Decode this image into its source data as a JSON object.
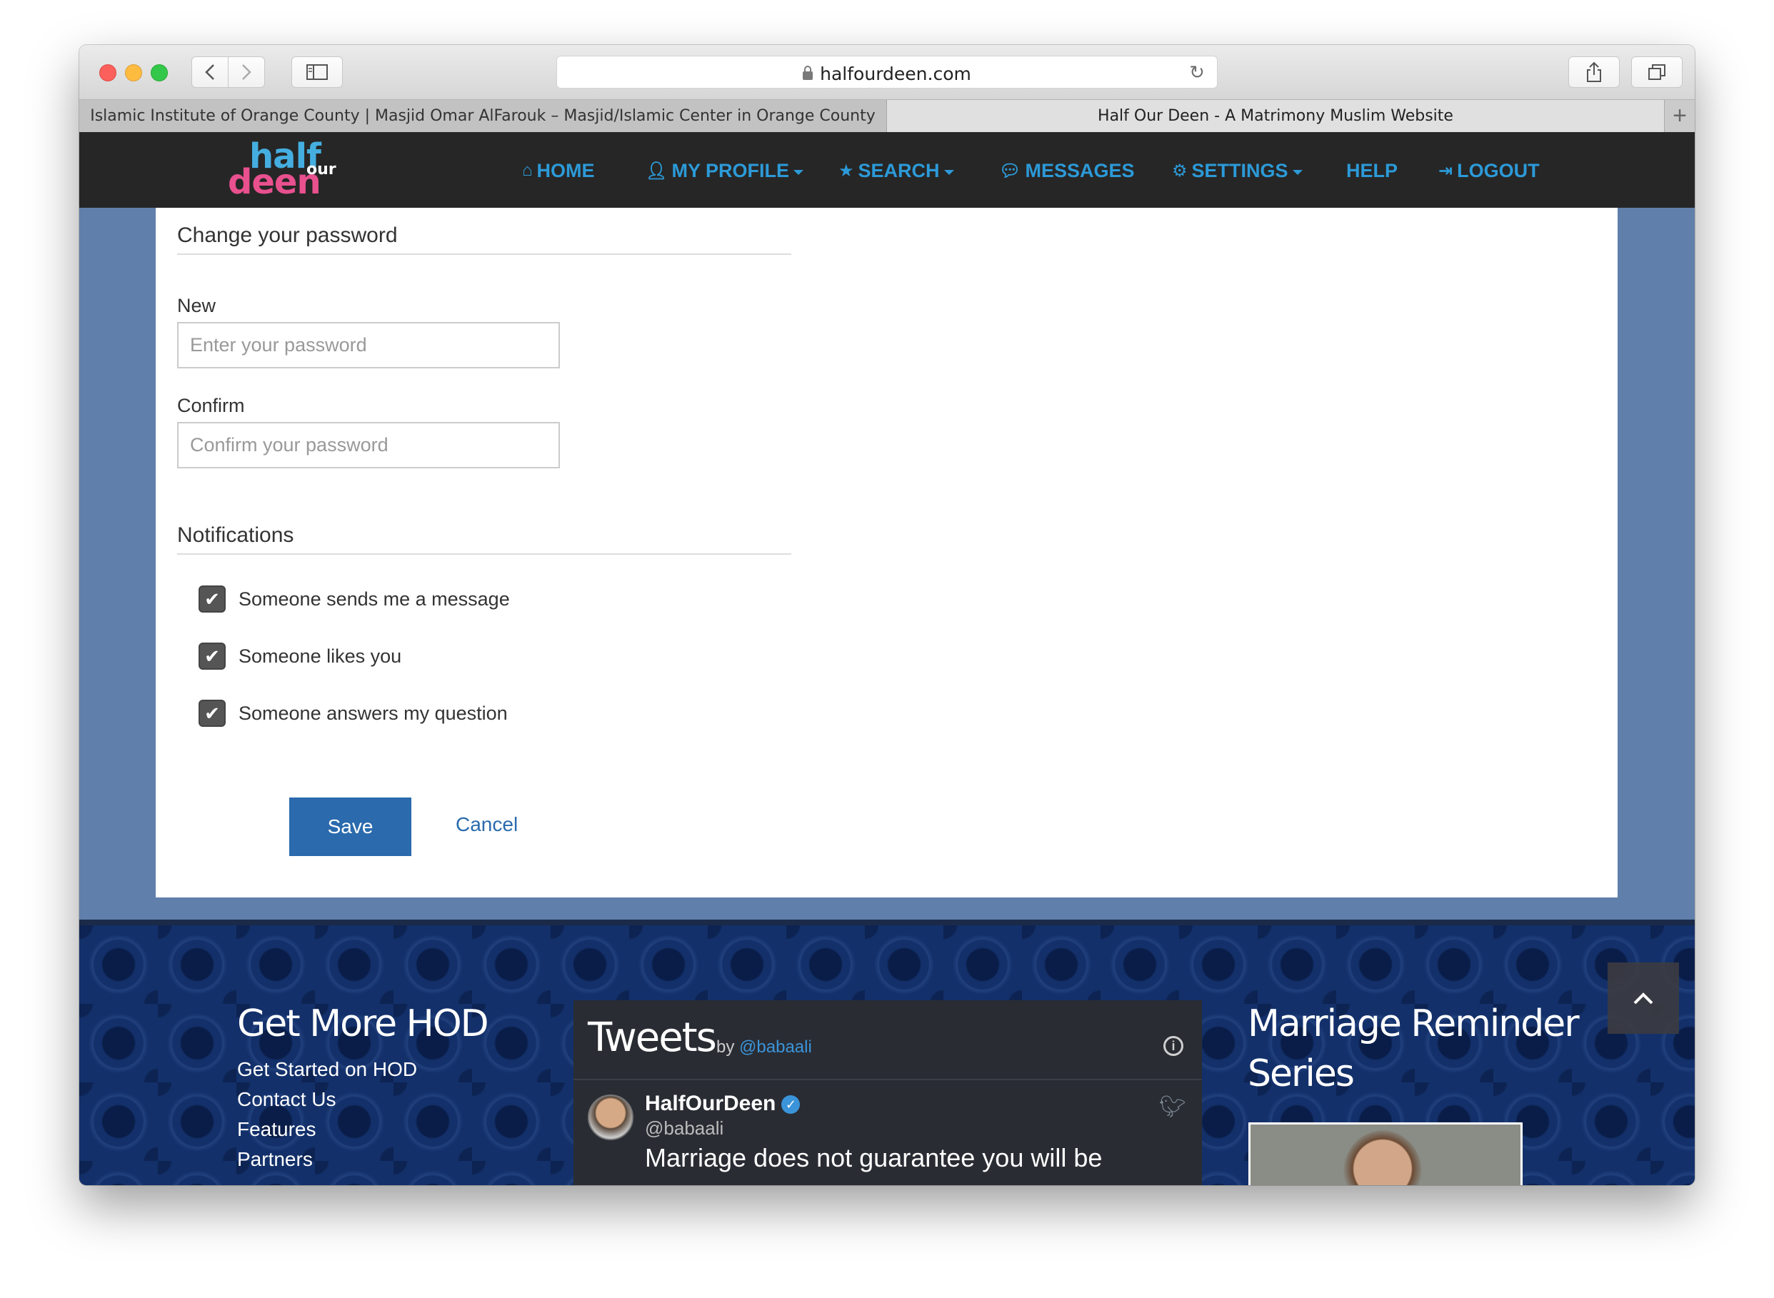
{
  "browser": {
    "url": "halfourdeen.com",
    "tabs": [
      {
        "title": "Islamic Institute of Orange County | Masjid Omar AlFarouk – Masjid/Islamic Center in Orange County"
      },
      {
        "title": "Half Our Deen - A Matrimony Muslim Website"
      }
    ],
    "new_tab_label": "+"
  },
  "site": {
    "logo": {
      "half": "half",
      "deen": "deen",
      "our": "our"
    },
    "nav": [
      {
        "label": "HOME",
        "icon": "home-icon"
      },
      {
        "label": "MY PROFILE",
        "icon": "user-icon",
        "dropdown": true
      },
      {
        "label": "SEARCH",
        "icon": "star-icon",
        "dropdown": true
      },
      {
        "label": "MESSAGES",
        "icon": "comments-icon"
      },
      {
        "label": "SETTINGS",
        "icon": "gear-icon",
        "dropdown": true
      },
      {
        "label": "HELP"
      },
      {
        "label": "LOGOUT",
        "icon": "logout-icon"
      }
    ]
  },
  "form": {
    "password_section_title": "Change your password",
    "new_label": "New",
    "new_placeholder": "Enter your password",
    "confirm_label": "Confirm",
    "confirm_placeholder": "Confirm your password",
    "notifications_title": "Notifications",
    "notifications": [
      {
        "label": "Someone sends me a message",
        "checked": true
      },
      {
        "label": "Someone likes you",
        "checked": true
      },
      {
        "label": "Someone answers my question",
        "checked": true
      }
    ],
    "save_label": "Save",
    "cancel_label": "Cancel"
  },
  "footer": {
    "get_more_title": "Get More HOD",
    "links": [
      "Get Started on HOD",
      "Contact Us",
      "Features",
      "Partners"
    ],
    "tweets": {
      "title": "Tweets",
      "by": "by",
      "handle": "@babaali",
      "tweet_name": "HalfOurDeen",
      "tweet_handle": "@babaali",
      "tweet_text": "Marriage does not guarantee you will be"
    },
    "reminder_title_line1": "Marriage Reminder",
    "reminder_title_line2": "Series"
  },
  "colors": {
    "accent": "#2c9ad8",
    "save_button": "#2a6aad",
    "page_background": "#607fab",
    "navbar": "#262626"
  }
}
